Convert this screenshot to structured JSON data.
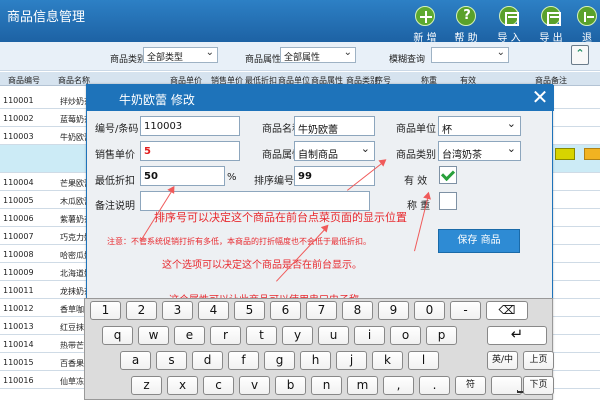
{
  "app": {
    "title": "商品信息管理"
  },
  "toolbar": {
    "new": "新 增",
    "help": "帮 助",
    "import": "导 入",
    "export": "导 出",
    "exit": "退"
  },
  "filters": {
    "category_label": "商品类别",
    "category_value": "全部类型",
    "attribute_label": "商品属性",
    "attribute_value": "全部属性",
    "fuzzy_label": "模糊查询"
  },
  "table": {
    "headers": [
      "商品编号",
      "商品名称",
      "商品单价",
      "销售单价",
      "最低折扣",
      "商品单位",
      "商品属性",
      "商品类别",
      "序号",
      "称重",
      "有效",
      "商品备注"
    ],
    "rows": [
      {
        "code": "110001",
        "name": "拌炒奶茶"
      },
      {
        "code": "110002",
        "name": "蓝莓奶茶"
      },
      {
        "code": "110003",
        "name": "牛奶欧蕾"
      },
      {
        "code": "",
        "name": ""
      },
      {
        "code": "110004",
        "name": "芒果欧蕾"
      },
      {
        "code": "110005",
        "name": "木瓜欧蕾"
      },
      {
        "code": "110006",
        "name": "紫薯奶茶"
      },
      {
        "code": "110007",
        "name": "巧克力奶茶"
      },
      {
        "code": "110008",
        "name": "哈密瓜奶茶"
      },
      {
        "code": "110009",
        "name": "北海道奶茶"
      },
      {
        "code": "110011",
        "name": "龙抹奶茶"
      },
      {
        "code": "110012",
        "name": "香草咖啡"
      },
      {
        "code": "110013",
        "name": "红豆抹茶"
      },
      {
        "code": "110014",
        "name": "热带芒果"
      },
      {
        "code": "110015",
        "name": "百香果奶茶"
      },
      {
        "code": "110016",
        "name": "仙草冻奶茶"
      }
    ]
  },
  "dialog": {
    "title": "牛奶欧蕾  修改",
    "fields": {
      "code_label": "编号/条码",
      "code_value": "110003",
      "name_label": "商品名称",
      "name_value": "牛奶欧蕾",
      "unit_label": "商品单位",
      "unit_value": "杯",
      "sale_price_label": "销售单价",
      "sale_price_value": "5",
      "attribute_label": "商品属性",
      "attribute_value": "自制商品",
      "category_label": "商品类别",
      "category_value": "台湾奶茶",
      "min_discount_label": "最低折扣",
      "min_discount_value": "50",
      "percent": "%",
      "sort_label": "排序编号",
      "sort_value": "99",
      "valid_label": "有   效",
      "remark_label": "备注说明",
      "weigh_label": "称   重"
    },
    "save": "保存 商品"
  },
  "annotations": {
    "sort_hint": "排序号可以决定这个商品在前台点菜页面的显示位置",
    "discount_hint": "注意：不管系统促销打折有多低，本商品的打折幅度也不会低于最低折扣。",
    "valid_hint": "这个选项可以决定这个商品是否在前台显示。",
    "weigh_hint": "这个属性可以让此商品可以使用串口电子称"
  },
  "keyboard": {
    "row1": [
      "1",
      "2",
      "3",
      "4",
      "5",
      "6",
      "7",
      "8",
      "9",
      "0",
      "-"
    ],
    "row2": [
      "q",
      "w",
      "e",
      "r",
      "t",
      "y",
      "u",
      "i",
      "o",
      "p"
    ],
    "row3": [
      "a",
      "s",
      "d",
      "f",
      "g",
      "h",
      "j",
      "k",
      "l"
    ],
    "row4": [
      "z",
      "x",
      "c",
      "v",
      "b",
      "n",
      "m"
    ],
    "lang": "英/中",
    "symbol": "符",
    "page_up": "上页",
    "page_down": "下页",
    "comma": ",",
    "period": "."
  },
  "colors": {
    "header_blue": "#1e73ba",
    "accent_red": "#e8292e",
    "row_highlight": "#ccebf6"
  }
}
